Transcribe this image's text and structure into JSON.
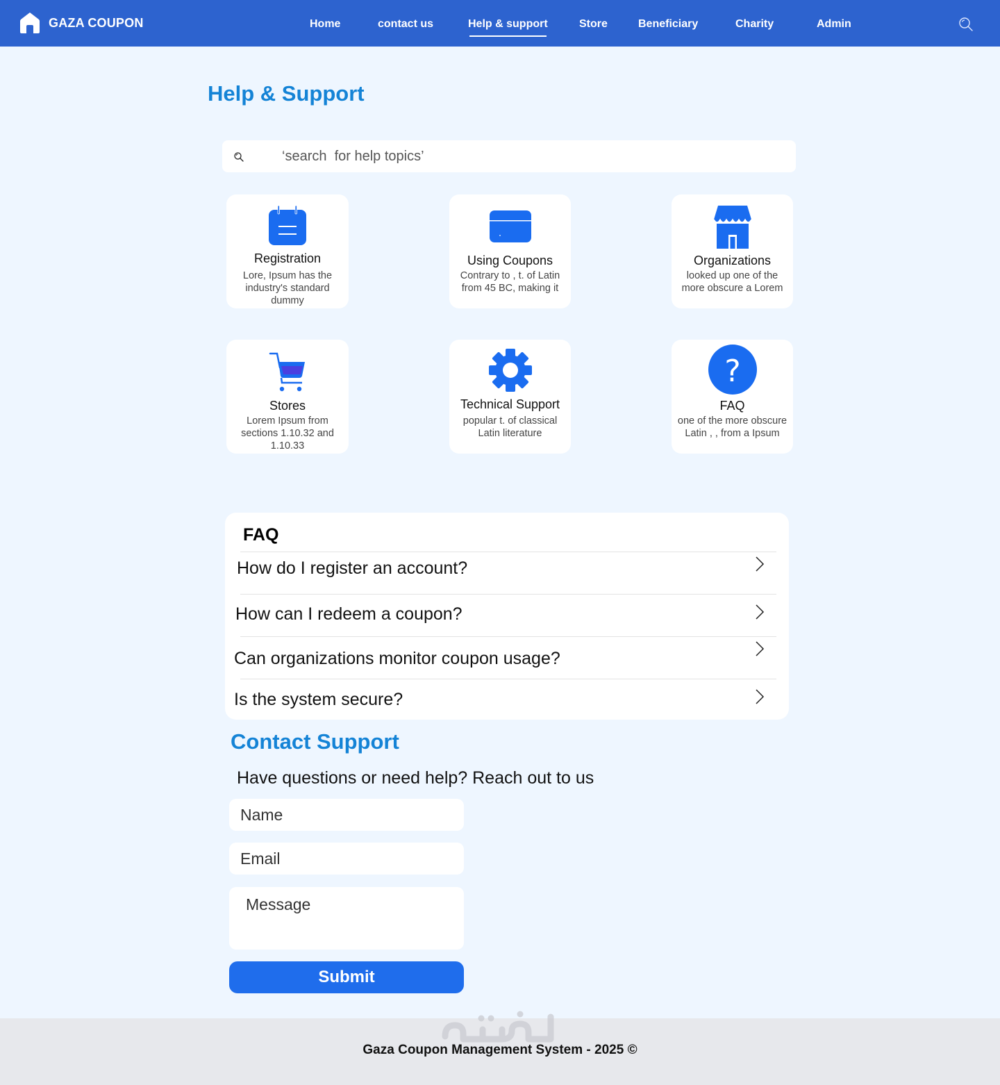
{
  "brand": {
    "name": "GAZA COUPON",
    "logo_icon": "home-icon"
  },
  "nav": {
    "items": [
      {
        "label": "Home",
        "active": false
      },
      {
        "label": "contact us",
        "active": false
      },
      {
        "label": "Help & support",
        "active": true
      },
      {
        "label": "Store",
        "active": false
      },
      {
        "label": "Beneficiary",
        "active": false
      },
      {
        "label": "Charity",
        "active": false
      },
      {
        "label": "Admin",
        "active": false
      }
    ],
    "search_icon": "search-icon"
  },
  "page": {
    "title": "Help & Support"
  },
  "search": {
    "placeholder": "‘search  for help topics’",
    "icon": "search-icon"
  },
  "categories": [
    {
      "title": "Registration",
      "description": "Lore,  Ipsum has  the industry's standard dummy",
      "icon": "calendar-icon"
    },
    {
      "title": "Using Coupons",
      "description": "Contrary to  , t.    of Latin  from 45 BC, making it",
      "icon": "card-icon"
    },
    {
      "title": "Organizations",
      "description": "looked up one of the more obscure  a Lorem",
      "icon": "storefront-icon"
    },
    {
      "title": "Stores",
      "description": "Lorem Ipsum  from sections 1.10.32 and 1.10.33",
      "icon": "cart-icon"
    },
    {
      "title": "Technical Support",
      "description": "popular  t.    of classical Latin literature",
      "icon": "gear-icon"
    },
    {
      "title": "FAQ",
      "description": "one of the more obscure Latin , , from a Ipsum",
      "icon": "question-icon"
    }
  ],
  "faq": {
    "heading": "FAQ",
    "items": [
      {
        "question": "How do I register an account?"
      },
      {
        "question": "How can I redeem a coupon?"
      },
      {
        "question": "Can organizations monitor coupon usage?"
      },
      {
        "question": "Is the system secure?"
      }
    ],
    "chevron_icon": "chevron-right-icon"
  },
  "contact": {
    "title": "Contact Support",
    "subtitle": "Have questions or need help? Reach out to us",
    "name_placeholder": "Name",
    "email_placeholder": "Email",
    "message_placeholder": "Message",
    "submit_label": "Submit"
  },
  "footer": {
    "text": "Gaza Coupon Management System - 2025 ©"
  },
  "colors": {
    "navbar": "#2d63cf",
    "accent": "#1483d6",
    "icon_blue": "#1a6cf0",
    "button": "#1f6dec",
    "page_bg": "#eef6ff",
    "footer_bg": "#e7e8ec"
  }
}
